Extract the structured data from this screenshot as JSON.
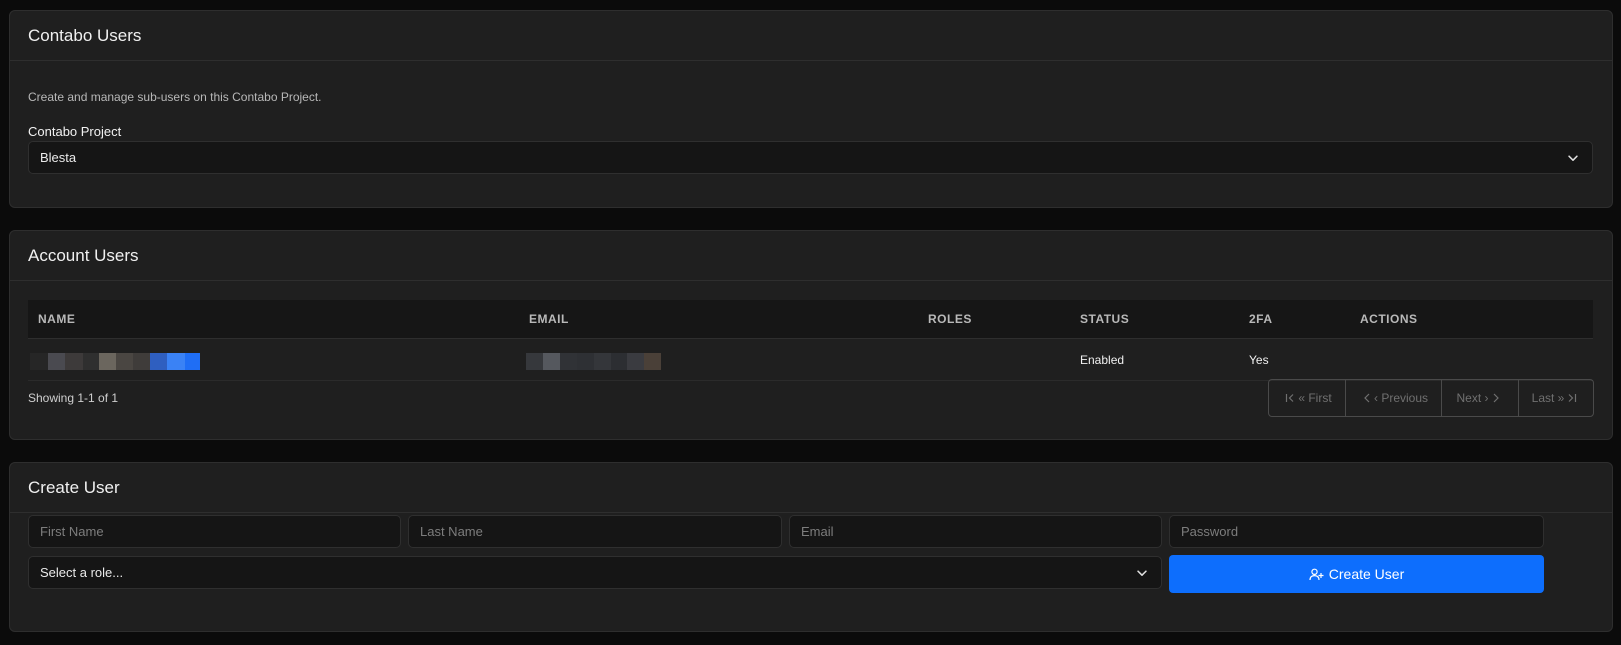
{
  "project_card": {
    "title": "Contabo Users",
    "description": "Create and manage sub-users on this Contabo Project.",
    "project_label": "Contabo Project",
    "project_selected": "Blesta"
  },
  "users_card": {
    "title": "Account Users",
    "columns": [
      "NAME",
      "EMAIL",
      "ROLES",
      "STATUS",
      "2FA",
      "ACTIONS"
    ],
    "rows": [
      {
        "name": "",
        "email": "",
        "roles": "",
        "status": "Enabled",
        "twofa": "Yes",
        "actions": ""
      }
    ],
    "showing": "Showing 1-1 of 1",
    "pagination": {
      "first": "« First",
      "previous": "‹ Previous",
      "next": "Next ›",
      "last": "Last »"
    }
  },
  "create_card": {
    "title": "Create User",
    "first_name_placeholder": "First Name",
    "last_name_placeholder": "Last Name",
    "email_placeholder": "Email",
    "password_placeholder": "Password",
    "role_selected": "Select a role...",
    "create_button_label": "Create User"
  },
  "colors": {
    "background": "#0b0b0b",
    "card": "#1f1f1f",
    "accent": "#0d6efd"
  },
  "icons": [
    "chevron-down-icon",
    "first-page-icon",
    "chevron-left-icon",
    "chevron-right-icon",
    "last-page-icon",
    "user-plus-icon"
  ]
}
